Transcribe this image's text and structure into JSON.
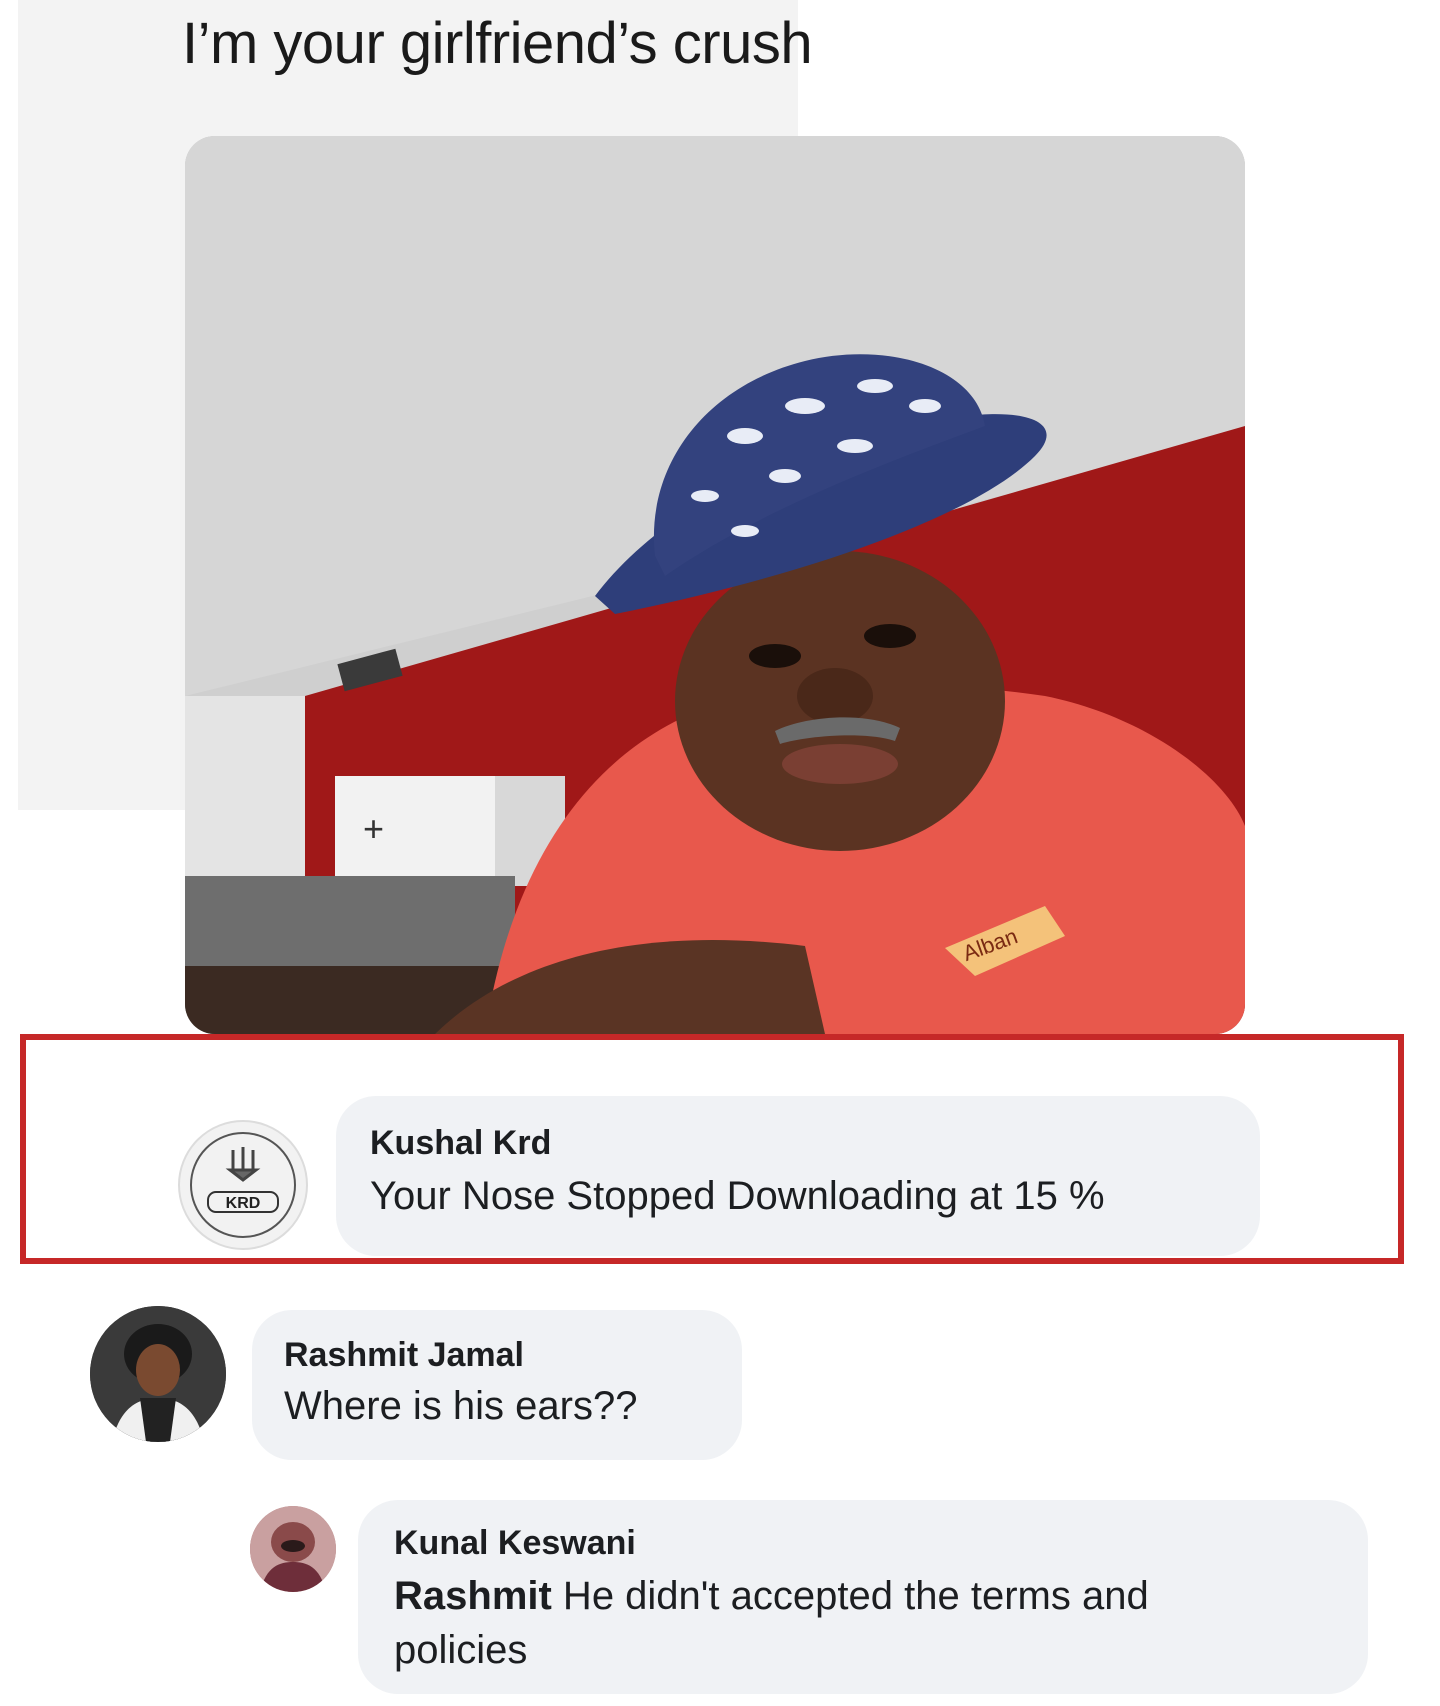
{
  "post": {
    "caption": "I’m your girlfriend’s crush",
    "photo": {
      "shirt_text": "Alban",
      "wall_sign": "+"
    }
  },
  "comments": [
    {
      "author": "Kushal Krd",
      "text": "Your Nose Stopped Downloading at 15 %",
      "avatar_text": "KRD",
      "highlighted": true
    },
    {
      "author": "Rashmit Jamal",
      "text": "Where is his ears??"
    }
  ],
  "reply": {
    "author": "Kunal Keswani",
    "mention": "Rashmit",
    "text": " He didn't accepted the terms and policies"
  },
  "colors": {
    "highlight_border": "#c62828",
    "bubble_background": "#f0f2f5",
    "shirt": "#e8584c",
    "wall_red": "#a01818"
  }
}
